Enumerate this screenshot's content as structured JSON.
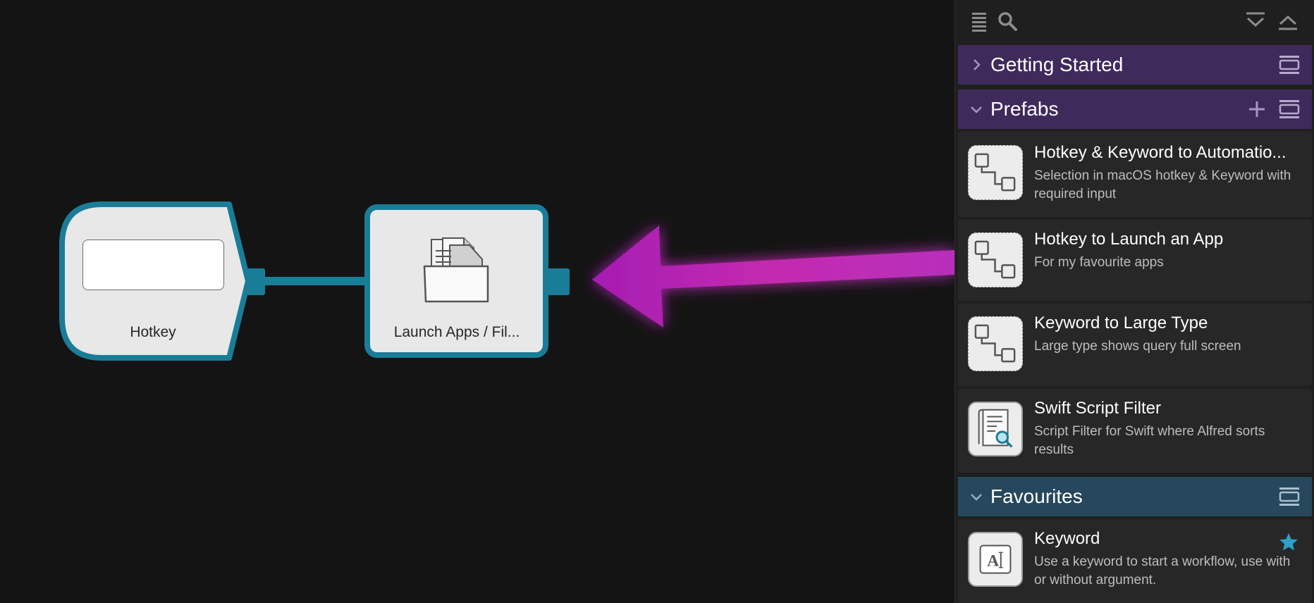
{
  "canvas": {
    "nodes": [
      {
        "type": "hotkey",
        "label": "Hotkey"
      },
      {
        "type": "launch-apps",
        "label": "Launch Apps / Fil..."
      }
    ]
  },
  "sidebar": {
    "sections": {
      "getting_started": {
        "title": "Getting Started"
      },
      "prefabs": {
        "title": "Prefabs",
        "items": [
          {
            "title": "Hotkey & Keyword to Automatio...",
            "subtitle": "Selection in macOS hotkey & Keyword with required input",
            "icon": "workflow-icon"
          },
          {
            "title": "Hotkey to Launch an App",
            "subtitle": "For my favourite apps",
            "icon": "workflow-icon"
          },
          {
            "title": "Keyword to Large Type",
            "subtitle": "Large type shows query full screen",
            "icon": "workflow-icon"
          },
          {
            "title": "Swift Script Filter",
            "subtitle": "Script Filter for Swift where Alfred sorts results",
            "icon": "script-filter-icon"
          }
        ]
      },
      "favourites": {
        "title": "Favourites",
        "items": [
          {
            "title": "Keyword",
            "subtitle": "Use a keyword to start a workflow, use with or without argument.",
            "icon": "keyword-icon",
            "starred": true
          }
        ]
      }
    }
  },
  "colors": {
    "node_border": "#1a7d98",
    "prefab_header": "#3f2a5c",
    "favourites_header": "#27475c",
    "arrow": "#c42bb0",
    "star": "#2fa0c8"
  }
}
